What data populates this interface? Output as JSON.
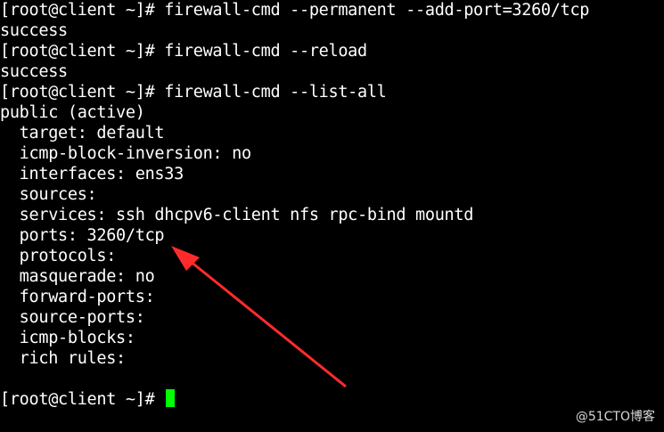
{
  "terminal": {
    "lines": [
      "[root@client ~]# firewall-cmd --permanent --add-port=3260/tcp",
      "success",
      "[root@client ~]# firewall-cmd --reload",
      "success",
      "[root@client ~]# firewall-cmd --list-all",
      "public (active)",
      "  target: default",
      "  icmp-block-inversion: no",
      "  interfaces: ens33",
      "  sources:",
      "  services: ssh dhcpv6-client nfs rpc-bind mountd",
      "  ports: 3260/tcp",
      "  protocols:",
      "  masquerade: no",
      "  forward-ports:",
      "  source-ports:",
      "  icmp-blocks:",
      "  rich rules:",
      "",
      "[root@client ~]# "
    ]
  },
  "cursor_color": "#00ff00",
  "annotation": {
    "arrow_color": "#ff2b2b"
  },
  "watermark": "@51CTO博客"
}
